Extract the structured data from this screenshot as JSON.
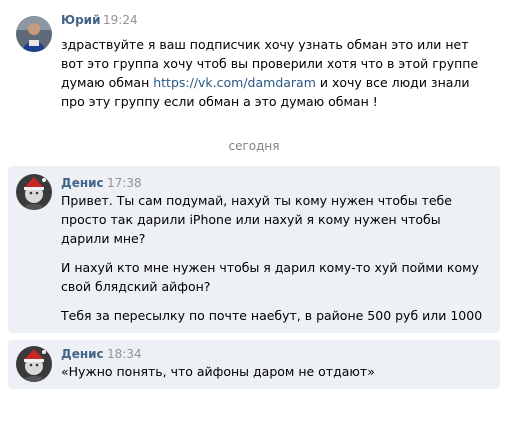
{
  "messages": [
    {
      "author": "Юрий",
      "time": "19:24",
      "avatar_icon": "user-avatar-icon",
      "lines": [
        "здраствуйте я ваш подписчик хочу узнать обман это или нет",
        "вот это группа хочу чтоб вы проверили хотя что в этой группе",
        "думаю обман ",
        " и хочу все люди знали",
        "про эту группу если обман а это думаю обман !"
      ],
      "link": "https://vk.com/damdaram"
    },
    {
      "author": "Денис",
      "time": "17:38",
      "avatar_icon": "user-avatar-icon",
      "paragraphs": [
        [
          "Привет. Ты сам подумай, нахуй ты кому нужен чтобы тебе",
          "просто так дарили iPhone или нахуй я кому нужен чтобы",
          "дарили мне?"
        ],
        [
          "И нахуй кто мне нужен чтобы я дарил кому-то хуй пойми кому",
          "свой блядский айфон?"
        ],
        [
          "Тебя за пересылку по почте наебут, в районе 500 руб или 1000"
        ]
      ]
    },
    {
      "author": "Денис",
      "time": "18:34",
      "avatar_icon": "user-avatar-icon",
      "lines": [
        "«Нужно понять, что айфоны даром не отдают»"
      ]
    }
  ],
  "date_separator": "сегодня",
  "colors": {
    "author": "#42648b",
    "link": "#2a5885",
    "time": "#939393",
    "highlight_bg": "#edf0f5"
  }
}
